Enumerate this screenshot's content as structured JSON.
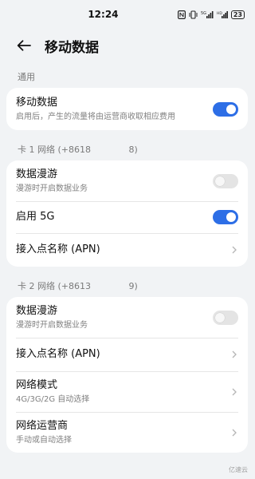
{
  "status_bar": {
    "time": "12:24",
    "battery": "23"
  },
  "header": {
    "title": "移动数据"
  },
  "sections": {
    "general": {
      "label": "通用",
      "mobile_data": {
        "title": "移动数据",
        "subtitle": "启用后，产生的流量将由运营商收取相应费用",
        "enabled": true
      }
    },
    "sim1": {
      "label": "卡 1 网络 (+8618     8)",
      "roaming": {
        "title": "数据漫游",
        "subtitle": "漫游时开启数据业务",
        "enabled": false
      },
      "enable_5g": {
        "title": "启用 5G",
        "enabled": true
      },
      "apn": {
        "title": "接入点名称 (APN)"
      }
    },
    "sim2": {
      "label": "卡 2 网络 (+8613     9)",
      "roaming": {
        "title": "数据漫游",
        "subtitle": "漫游时开启数据业务",
        "enabled": false
      },
      "apn": {
        "title": "接入点名称 (APN)"
      },
      "network_mode": {
        "title": "网络模式",
        "subtitle": "4G/3G/2G 自动选择"
      },
      "carrier": {
        "title": "网络运营商",
        "subtitle": "手动或自动选择"
      }
    }
  },
  "watermark": "亿速云",
  "colors": {
    "accent": "#2d6ee6",
    "background": "#f1f3f5"
  }
}
